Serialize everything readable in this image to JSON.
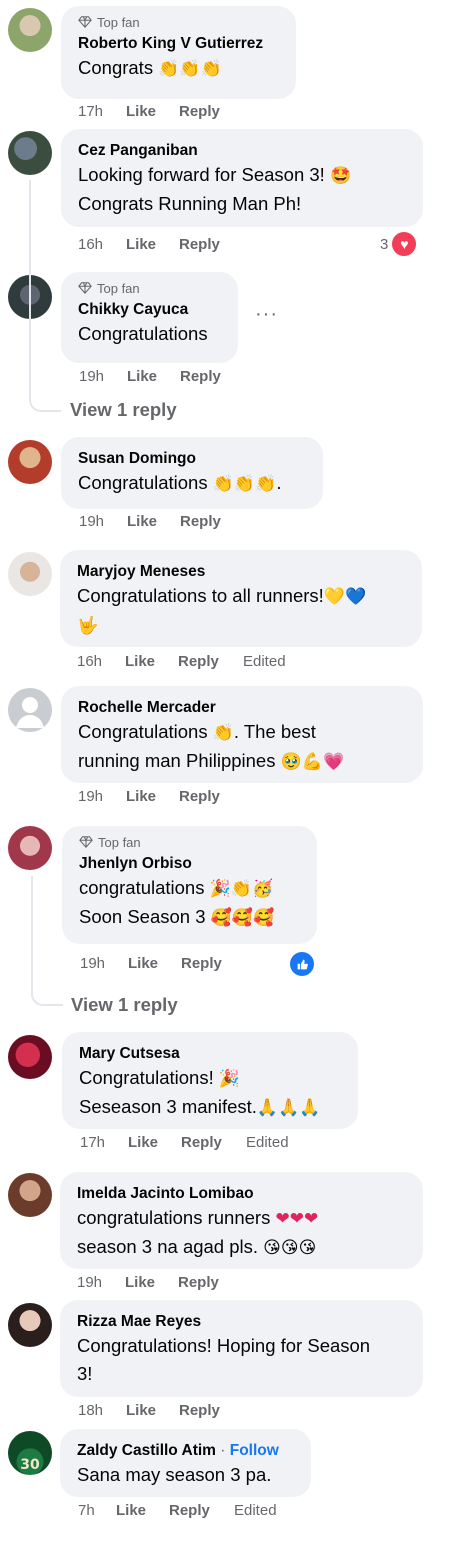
{
  "labels": {
    "like": "Like",
    "reply": "Reply",
    "edited": "Edited",
    "top_fan": "Top fan",
    "view_reply": "View 1 reply",
    "follow": "Follow",
    "separator": "·"
  },
  "comments": [
    {
      "author": "Roberto King V Gutierrez",
      "badge": "Top fan",
      "text": "Congrats",
      "emoji": "👏👏👏",
      "time": "17h"
    },
    {
      "author": "Cez Panganiban",
      "text_line1": "Looking forward for Season 3!",
      "emoji1": "🤩",
      "text_line2": "Congrats Running Man Ph!",
      "time": "16h",
      "reaction_count": "3"
    },
    {
      "author": "Chikky Cayuca",
      "badge": "Top fan",
      "text": "Congratulations",
      "time": "19h",
      "more": "···",
      "view_reply": "View 1 reply"
    },
    {
      "author": "Susan Domingo",
      "text": "Congratulations",
      "emoji": "👏👏👏.",
      "time": "19h"
    },
    {
      "author": "Maryjoy Meneses",
      "text": "Congratulations to all runners!",
      "emoji1": "💛💙",
      "emoji2": "🤟",
      "time": "16h",
      "edited": "Edited"
    },
    {
      "author": "Rochelle Mercader",
      "text_line1a": "Congratulations",
      "emoji1": "👏",
      "text_line1b": ". The best",
      "text_line2": "running man Philippines",
      "emoji2": "🥹💪💗",
      "time": "19h"
    },
    {
      "author": "Jhenlyn Orbiso",
      "badge": "Top fan",
      "text_line1": "congratulations",
      "emoji1": "🎉👏🥳",
      "text_line2": "Soon Season 3",
      "emoji2": "🥰🥰🥰",
      "time": "19h",
      "view_reply": "View 1 reply"
    },
    {
      "author": "Mary Cutsesa",
      "text_line1": "Congratulations!",
      "emoji1": "🎉",
      "text_line2": "Seseason 3 manifest.",
      "emoji2": "🙏🙏🙏",
      "time": "17h",
      "edited": "Edited"
    },
    {
      "author": "Imelda Jacinto Lomibao",
      "text_line1": "congratulations runners",
      "emoji1": "❤❤❤",
      "text_line2": "season 3 na agad pls.",
      "emoji2": "😘😘😘",
      "time": "19h"
    },
    {
      "author": "Rizza Mae Reyes",
      "text_line1": "Congratulations! Hoping for Season",
      "text_line2": "3!",
      "time": "18h"
    },
    {
      "author": "Zaldy Castillo Atim",
      "follow": "Follow",
      "text": "Sana may season 3 pa.",
      "time": "7h",
      "edited": "Edited"
    }
  ],
  "colors": {
    "bubble": "#f0f2f5",
    "secondary_text": "#65676b",
    "link_blue": "#1877f2",
    "heart_red": "#f33e58"
  }
}
